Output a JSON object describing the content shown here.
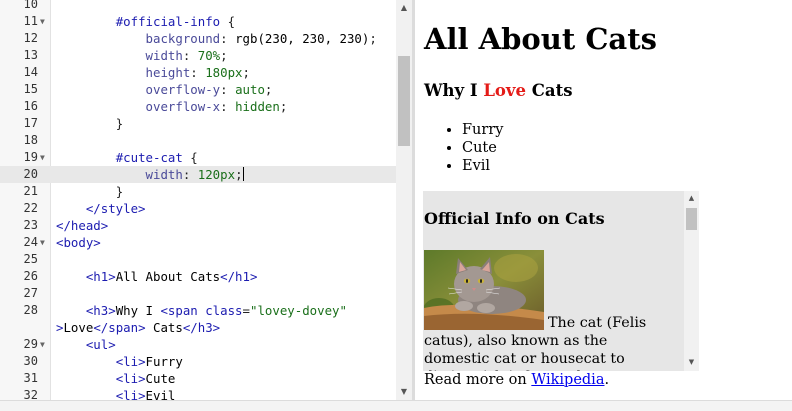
{
  "editor": {
    "lines": [
      {
        "num": "10",
        "fold": false,
        "tokens": [
          [
            "default",
            ""
          ]
        ]
      },
      {
        "num": "11",
        "fold": true,
        "tokens": [
          [
            "default",
            "        "
          ],
          [
            "sel",
            "#official-info"
          ],
          [
            "punc",
            " {"
          ]
        ]
      },
      {
        "num": "12",
        "fold": false,
        "tokens": [
          [
            "default",
            "            "
          ],
          [
            "prop",
            "background"
          ],
          [
            "punc",
            ": "
          ],
          [
            "default",
            "rgb(230, 230, 230)"
          ],
          [
            "punc",
            ";"
          ]
        ]
      },
      {
        "num": "13",
        "fold": false,
        "tokens": [
          [
            "default",
            "            "
          ],
          [
            "prop",
            "width"
          ],
          [
            "punc",
            ": "
          ],
          [
            "val",
            "70%"
          ],
          [
            "punc",
            ";"
          ]
        ]
      },
      {
        "num": "14",
        "fold": false,
        "tokens": [
          [
            "default",
            "            "
          ],
          [
            "prop",
            "height"
          ],
          [
            "punc",
            ": "
          ],
          [
            "val",
            "180px"
          ],
          [
            "punc",
            ";"
          ]
        ]
      },
      {
        "num": "15",
        "fold": false,
        "tokens": [
          [
            "default",
            "            "
          ],
          [
            "prop",
            "overflow-y"
          ],
          [
            "punc",
            ": "
          ],
          [
            "val",
            "auto"
          ],
          [
            "punc",
            ";"
          ]
        ]
      },
      {
        "num": "16",
        "fold": false,
        "tokens": [
          [
            "default",
            "            "
          ],
          [
            "prop",
            "overflow-x"
          ],
          [
            "punc",
            ": "
          ],
          [
            "val",
            "hidden"
          ],
          [
            "punc",
            ";"
          ]
        ]
      },
      {
        "num": "17",
        "fold": false,
        "tokens": [
          [
            "default",
            "        "
          ],
          [
            "punc",
            "}"
          ]
        ]
      },
      {
        "num": "18",
        "fold": false,
        "tokens": [
          [
            "default",
            ""
          ]
        ]
      },
      {
        "num": "19",
        "fold": true,
        "tokens": [
          [
            "default",
            "        "
          ],
          [
            "sel",
            "#cute-cat"
          ],
          [
            "punc",
            " {"
          ]
        ]
      },
      {
        "num": "20",
        "fold": false,
        "active": true,
        "cursor": true,
        "tokens": [
          [
            "default",
            "            "
          ],
          [
            "prop",
            "width"
          ],
          [
            "punc",
            ": "
          ],
          [
            "val",
            "120px"
          ],
          [
            "punc",
            ";"
          ]
        ]
      },
      {
        "num": "21",
        "fold": false,
        "tokens": [
          [
            "default",
            "        "
          ],
          [
            "punc",
            "}"
          ]
        ]
      },
      {
        "num": "22",
        "fold": false,
        "tokens": [
          [
            "default",
            "    "
          ],
          [
            "tag",
            "</style>"
          ]
        ]
      },
      {
        "num": "23",
        "fold": false,
        "tokens": [
          [
            "tag",
            "</head>"
          ]
        ]
      },
      {
        "num": "24",
        "fold": true,
        "tokens": [
          [
            "tag",
            "<body>"
          ]
        ]
      },
      {
        "num": "25",
        "fold": false,
        "tokens": [
          [
            "default",
            ""
          ]
        ]
      },
      {
        "num": "26",
        "fold": false,
        "tokens": [
          [
            "default",
            "    "
          ],
          [
            "tag",
            "<h1>"
          ],
          [
            "default",
            "All About Cats"
          ],
          [
            "tag",
            "</h1>"
          ]
        ]
      },
      {
        "num": "27",
        "fold": false,
        "tokens": [
          [
            "default",
            ""
          ]
        ]
      },
      {
        "num": "28",
        "fold": false,
        "tokens": [
          [
            "default",
            "    "
          ],
          [
            "tag",
            "<h3>"
          ],
          [
            "default",
            "Why I "
          ],
          [
            "tag",
            "<span "
          ],
          [
            "attr",
            "class"
          ],
          [
            "punc",
            "="
          ],
          [
            "str",
            "\"lovey-dovey\""
          ]
        ]
      },
      {
        "num": "",
        "fold": false,
        "tokens": [
          [
            "tag",
            ">"
          ],
          [
            "default",
            "Love"
          ],
          [
            "tag",
            "</span>"
          ],
          [
            "default",
            " Cats"
          ],
          [
            "tag",
            "</h3>"
          ]
        ]
      },
      {
        "num": "29",
        "fold": true,
        "tokens": [
          [
            "default",
            "    "
          ],
          [
            "tag",
            "<ul>"
          ]
        ]
      },
      {
        "num": "30",
        "fold": false,
        "tokens": [
          [
            "default",
            "        "
          ],
          [
            "tag",
            "<li>"
          ],
          [
            "default",
            "Furry"
          ]
        ]
      },
      {
        "num": "31",
        "fold": false,
        "tokens": [
          [
            "default",
            "        "
          ],
          [
            "tag",
            "<li>"
          ],
          [
            "default",
            "Cute"
          ]
        ]
      },
      {
        "num": "32",
        "fold": false,
        "tokens": [
          [
            "default",
            "        "
          ],
          [
            "tag",
            "<li>"
          ],
          [
            "default",
            "Evil"
          ]
        ]
      }
    ]
  },
  "preview": {
    "h1": "All About Cats",
    "h3_before": "Why I ",
    "h3_love": "Love",
    "h3_after": " Cats",
    "list": [
      "Furry",
      "Cute",
      "Evil"
    ],
    "info_title": "Official Info on Cats",
    "info_text": "The cat (Felis catus), also known as the domestic cat or housecat to distinguish it from other",
    "readmore_prefix": "Read more on ",
    "readmore_link": "Wikipedia",
    "readmore_suffix": "."
  },
  "colors": {
    "love": "#e41b17",
    "info_background": "#e6e6e6",
    "link": "#0000ee"
  }
}
